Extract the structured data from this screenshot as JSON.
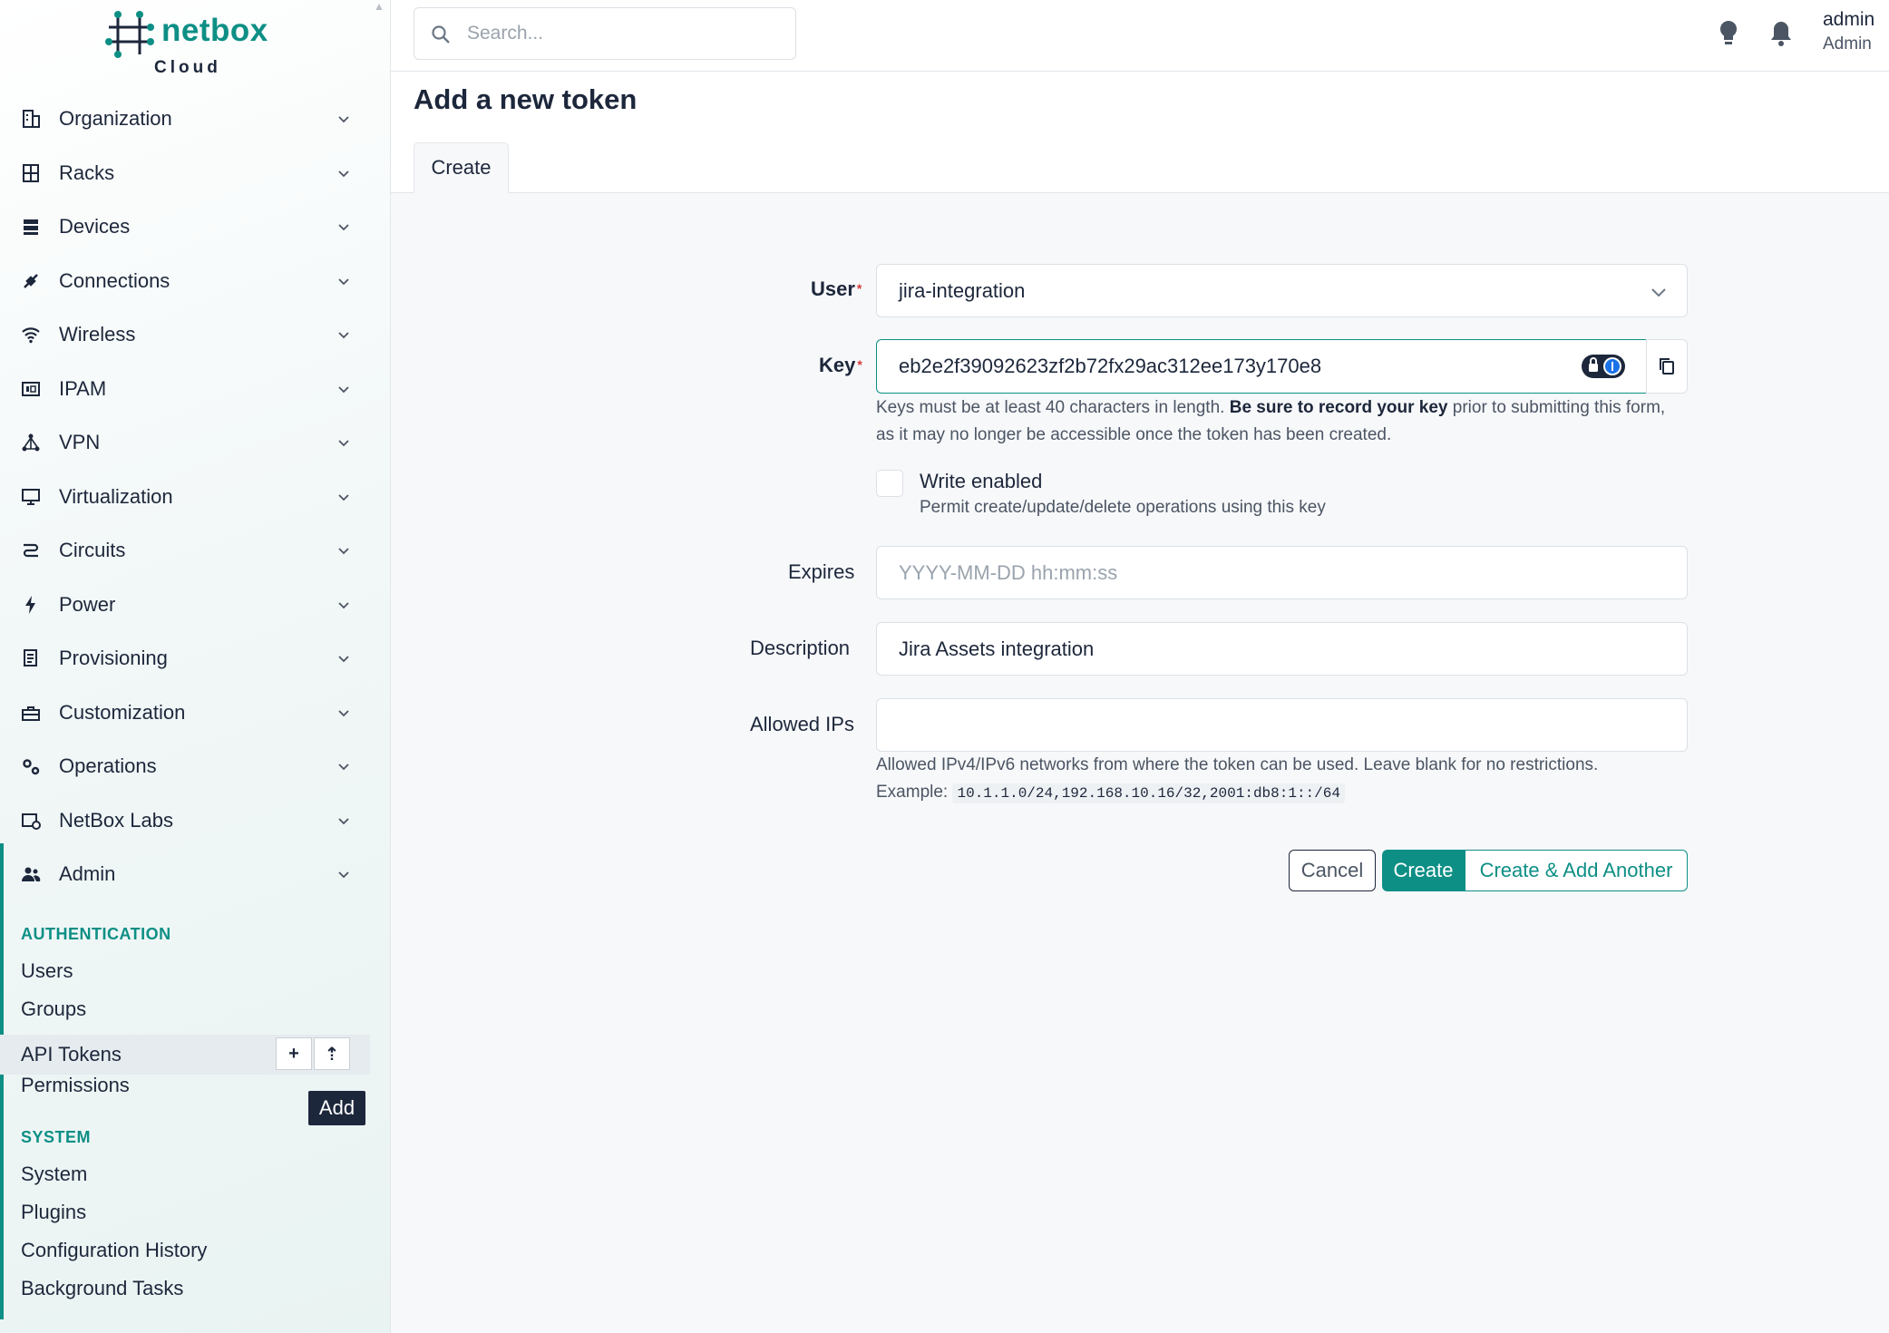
{
  "brand": {
    "name": "netbox",
    "sub": "Cloud",
    "color": "#0d8f85"
  },
  "search": {
    "placeholder": "Search..."
  },
  "user": {
    "name": "admin",
    "role": "Admin"
  },
  "nav": [
    {
      "label": "Organization",
      "icon": "building-icon"
    },
    {
      "label": "Racks",
      "icon": "rack-icon"
    },
    {
      "label": "Devices",
      "icon": "server-icon"
    },
    {
      "label": "Connections",
      "icon": "plug-icon"
    },
    {
      "label": "Wireless",
      "icon": "wifi-icon"
    },
    {
      "label": "IPAM",
      "icon": "ip-icon"
    },
    {
      "label": "VPN",
      "icon": "vpn-icon"
    },
    {
      "label": "Virtualization",
      "icon": "monitor-icon"
    },
    {
      "label": "Circuits",
      "icon": "circuit-icon"
    },
    {
      "label": "Power",
      "icon": "bolt-icon"
    },
    {
      "label": "Provisioning",
      "icon": "file-icon"
    },
    {
      "label": "Customization",
      "icon": "toolbox-icon"
    },
    {
      "label": "Operations",
      "icon": "gears-icon"
    },
    {
      "label": "NetBox Labs",
      "icon": "labs-icon"
    },
    {
      "label": "Admin",
      "icon": "users-icon"
    }
  ],
  "admin_menu": {
    "authentication_header": "AUTHENTICATION",
    "authentication_items": [
      "Users",
      "Groups",
      "API Tokens",
      "Permissions"
    ],
    "system_header": "SYSTEM",
    "system_items": [
      "System",
      "Plugins",
      "Configuration History",
      "Background Tasks"
    ],
    "add_button": "+",
    "import_button": "⇡",
    "tooltip": "Add"
  },
  "page": {
    "title": "Add a new token",
    "tab": "Create"
  },
  "form": {
    "user_label": "User",
    "user_value": "jira-integration",
    "key_label": "Key",
    "key_value": "eb2e2f39092623zf2b72fx29ac312ee173y170e8",
    "key_help_1": "Keys must be at least 40 characters in length.",
    "key_help_bold": "Be sure to record your key",
    "key_help_2": "prior to submitting this form,",
    "key_help_3": "as it may no longer be accessible once the token has been created.",
    "write_label": "Write enabled",
    "write_help": "Permit create/update/delete operations using this key",
    "write_checked": false,
    "expires_label": "Expires",
    "expires_placeholder": "YYYY-MM-DD hh:mm:ss",
    "description_label": "Description",
    "description_value": "Jira Assets integration",
    "allowed_ips_label": "Allowed IPs",
    "allowed_ips_value": "",
    "allowed_ips_help": "Allowed IPv4/IPv6 networks from where the token can be used. Leave blank for no restrictions.",
    "allowed_ips_example_label": "Example:",
    "allowed_ips_example": "10.1.1.0/24,192.168.10.16/32,2001:db8:1::/64",
    "required_mark": "*"
  },
  "buttons": {
    "cancel": "Cancel",
    "create": "Create",
    "create_another": "Create & Add Another"
  }
}
